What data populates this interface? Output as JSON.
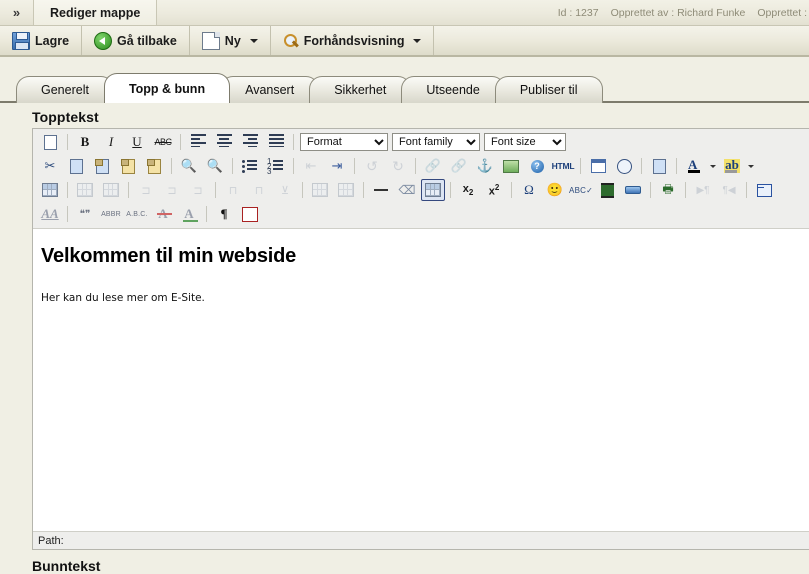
{
  "titlebar": {
    "chevron": "»",
    "tab_label": "Rediger mappe",
    "meta": {
      "id": "Id : 1237",
      "created_by": "Opprettet av : Richard Funke",
      "created": "Opprettet :"
    }
  },
  "commandbar": {
    "buttons": [
      {
        "label": "Lagre",
        "icon": "save-icon",
        "has_caret": false
      },
      {
        "label": "Gå tilbake",
        "icon": "back-arrow-icon",
        "has_caret": false
      },
      {
        "label": "Ny",
        "icon": "new-page-icon",
        "has_caret": true
      },
      {
        "label": "Forhåndsvisning",
        "icon": "magnifier-icon",
        "has_caret": true
      }
    ]
  },
  "tabs": [
    {
      "label": "Generelt",
      "active": false
    },
    {
      "label": "Topp & bunn",
      "active": true
    },
    {
      "label": "Avansert",
      "active": false
    },
    {
      "label": "Sikkerhet",
      "active": false
    },
    {
      "label": "Utseende",
      "active": false
    },
    {
      "label": "Publiser til",
      "active": false
    }
  ],
  "sections": {
    "header_label": "Topptekst",
    "footer_label": "Bunntekst"
  },
  "editor": {
    "dropdowns": {
      "format": "Format",
      "font_family": "Font family",
      "font_size": "Font size"
    },
    "content": {
      "heading": "Velkommen til min webside",
      "paragraph": "Her kan du lese mer om E-Site."
    },
    "statusbar": "Path:",
    "toolbar_rows": [
      [
        "new-document-icon",
        "bold-icon",
        "italic-icon",
        "underline-icon",
        "strikethrough-icon",
        "align-left-icon",
        "align-center-icon",
        "align-right-icon",
        "align-justify-icon",
        "format-select",
        "fontfamily-select",
        "fontsize-select"
      ],
      [
        "cut-icon",
        "copy-icon",
        "paste-icon",
        "paste-text-icon",
        "paste-word-icon",
        "find-icon",
        "find-replace-icon",
        "bullet-list-icon",
        "numbered-list-icon",
        "outdent-icon",
        "indent-icon",
        "undo-icon",
        "redo-icon",
        "link-icon",
        "unlink-icon",
        "anchor-icon",
        "image-icon",
        "help-icon",
        "html-icon",
        "insert-date-icon",
        "insert-time-icon",
        "preview-icon",
        "text-color-icon",
        "background-color-icon"
      ],
      [
        "table-properties-icon",
        "row-properties-icon",
        "cell-properties-icon",
        "insert-row-before-icon",
        "insert-row-after-icon",
        "delete-row-icon",
        "insert-column-before-icon",
        "insert-column-after-icon",
        "delete-column-icon",
        "split-cells-icon",
        "merge-cells-icon",
        "horizontal-rule-icon",
        "remove-format-icon",
        "insert-table-icon",
        "subscript-icon",
        "superscript-icon",
        "special-character-icon",
        "emoticon-icon",
        "spellcheck-icon",
        "media-icon",
        "page-break-icon",
        "print-icon",
        "ltr-icon",
        "rtl-icon",
        "fullscreen-icon"
      ],
      [
        "styles-icon",
        "citation-icon",
        "abbreviation-icon",
        "acronym-icon",
        "delete-text-icon",
        "insert-text-icon",
        "visual-characters-icon",
        "nonbreaking-icon"
      ]
    ],
    "colors": {
      "text_color": "#000000",
      "background_color": "#ffff00",
      "active_button_border": "#34487e"
    }
  }
}
